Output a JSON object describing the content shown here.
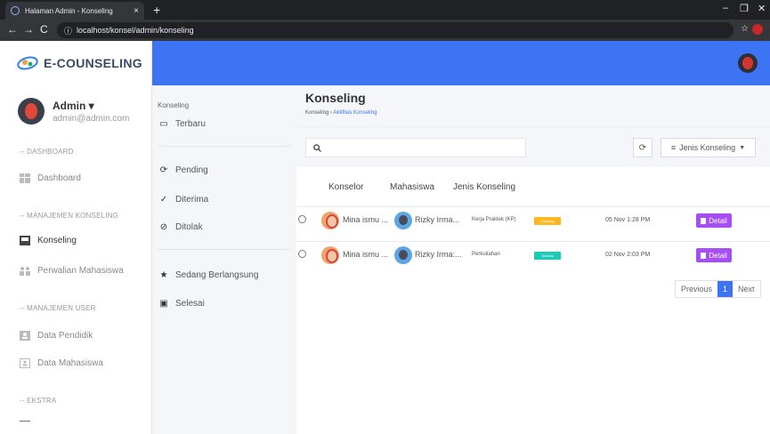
{
  "browser": {
    "tab_title": "Halaman Admin - Konseling",
    "tab_close": "×",
    "new_tab": "+",
    "url": "localhost/konsel/admin/konseling"
  },
  "brand": {
    "name": "E-COUNSELING"
  },
  "user": {
    "name": "Admin ▾",
    "email": "admin@admin.com"
  },
  "sidebar": {
    "sections": [
      {
        "label": "-- DASHBOARD",
        "items": [
          {
            "label": "Dashboard",
            "icon": "dashboard-icon"
          }
        ]
      },
      {
        "label": "-- MANAJEMEN KONSELING",
        "items": [
          {
            "label": "Konseling",
            "icon": "konseling-icon",
            "active": true
          },
          {
            "label": "Perwalian Mahasiswa",
            "icon": "users-icon"
          }
        ]
      },
      {
        "label": "-- MANAJEMEN USER",
        "items": [
          {
            "label": "Data Pendidik",
            "icon": "pendidik-icon"
          },
          {
            "label": "Data Mahasiswa",
            "icon": "mahasiswa-icon"
          }
        ]
      },
      {
        "label": "-- EKSTRA",
        "items": []
      }
    ]
  },
  "subnav": {
    "heading": "Konseling",
    "items": [
      {
        "label": "Terbaru",
        "icon": "monitor-icon"
      },
      {
        "label": "Pending",
        "icon": "pending-icon"
      },
      {
        "label": "Diterima",
        "icon": "check-icon"
      },
      {
        "label": "Ditolak",
        "icon": "ban-icon"
      },
      {
        "label": "Sedang Berlangsung",
        "icon": "star-icon"
      },
      {
        "label": "Selesai",
        "icon": "bookmark-icon"
      }
    ]
  },
  "page": {
    "title": "Konseling",
    "breadcrumb_root": "Konseling",
    "breadcrumb_sep": "›",
    "breadcrumb_current": "Aktifitas Konseling"
  },
  "toolbar": {
    "search_value": "",
    "filter_label": "Jenis Konseling"
  },
  "table": {
    "columns": [
      "Konselor",
      "Mahasiswa",
      "Jenis Konseling"
    ],
    "rows": [
      {
        "konselor": "Mina ismu ...",
        "mahasiswa": "Rizky Irma...",
        "jenis": "Kerja Praktek (KP)",
        "status": "Pending",
        "status_color": "#ffb822",
        "tanggal": "05 Nov 1:28 PM",
        "action": "Detail"
      },
      {
        "konselor": "Mina ismu ...",
        "mahasiswa": "Rizky Irma:...",
        "jenis": "Perkuliahan",
        "status": "Selesai",
        "status_color": "#1dc9b7",
        "tanggal": "02 Nov 2:03 PM",
        "action": "Detail"
      }
    ]
  },
  "pagination": {
    "previous": "Previous",
    "current": "1",
    "next": "Next"
  },
  "colors": {
    "primary": "#3d74f4",
    "detail": "#a54ef5"
  }
}
